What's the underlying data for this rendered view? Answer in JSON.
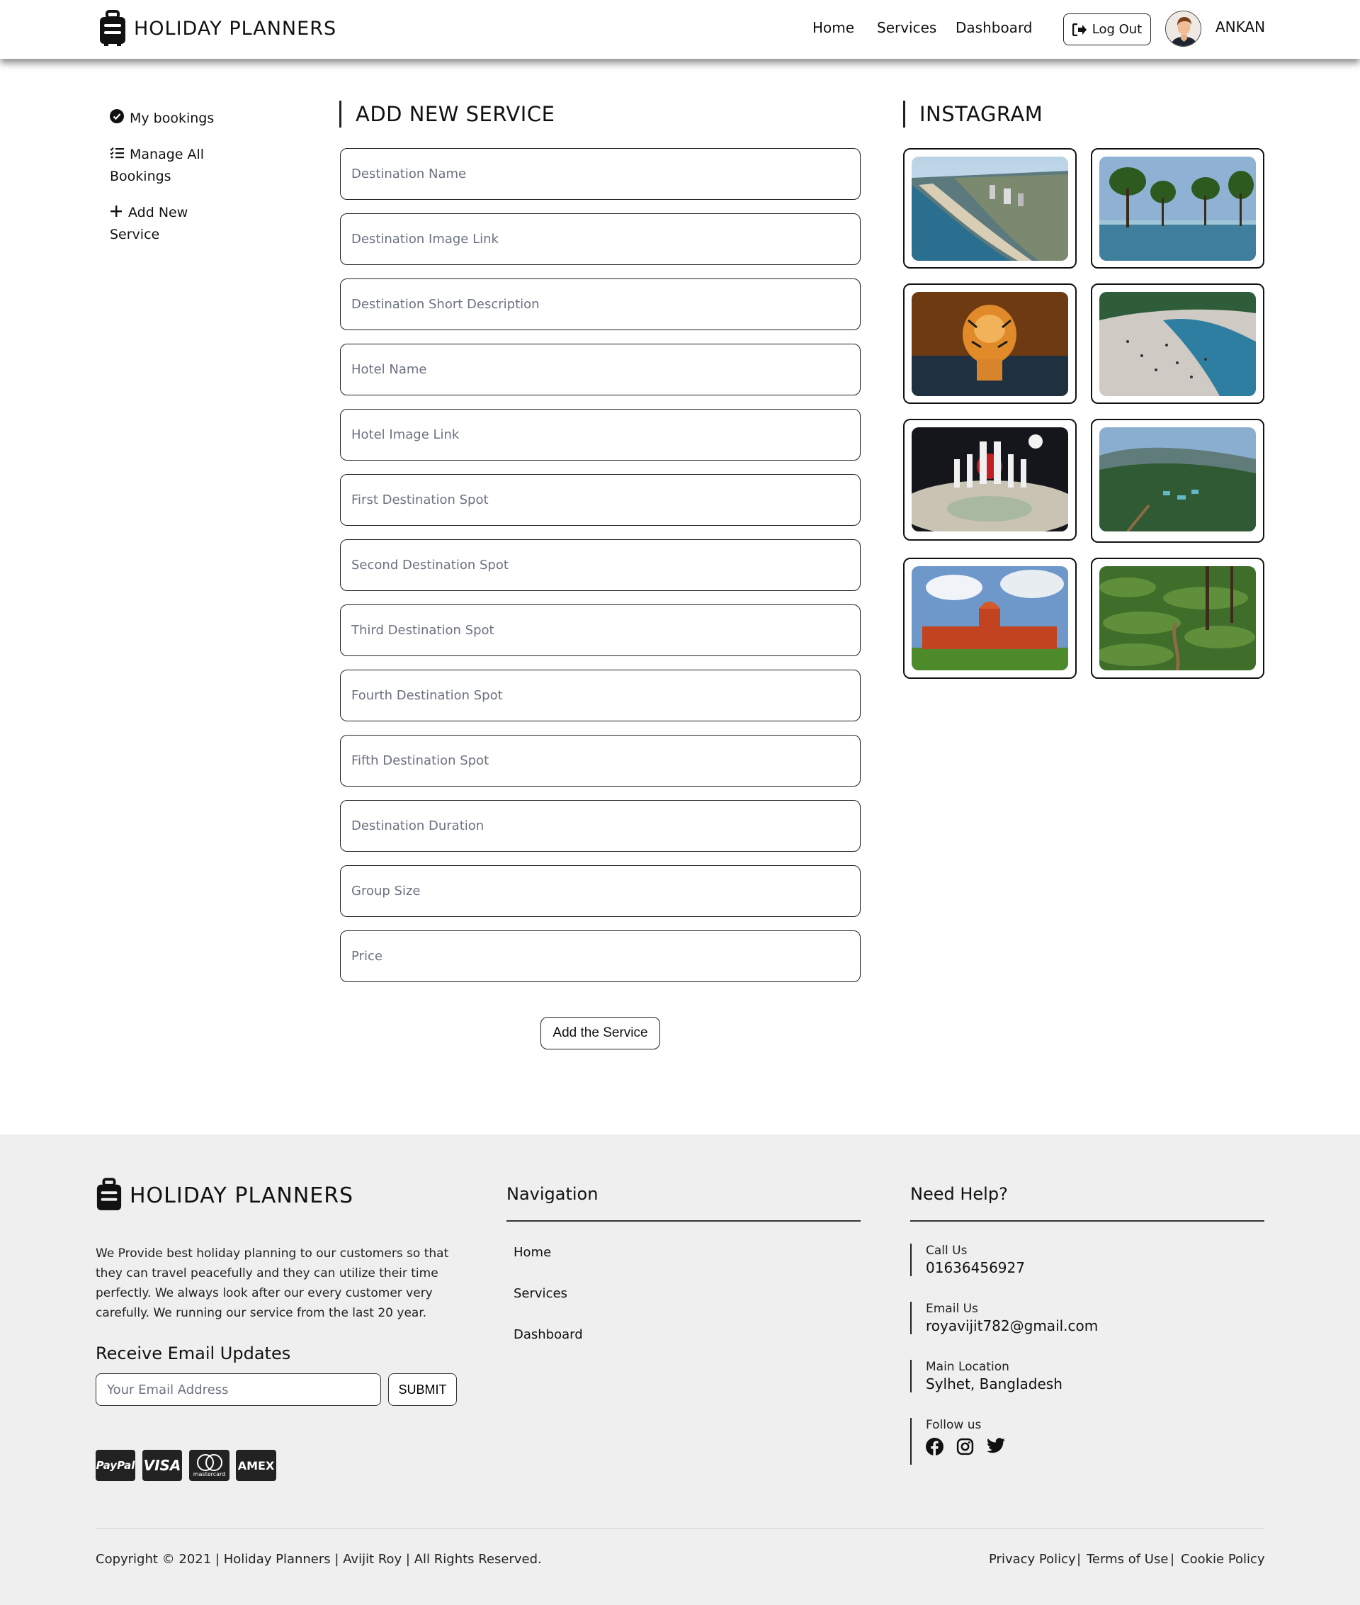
{
  "header": {
    "brand": "HOLIDAY PLANNERS",
    "nav": [
      "Home",
      "Services",
      "Dashboard"
    ],
    "logout_label": "Log Out",
    "user_name": "ANKAN"
  },
  "sidebar": {
    "items": [
      {
        "label": "My bookings",
        "icon": "check-circle-icon"
      },
      {
        "label_line1": "Manage All",
        "label_line2": "Bookings",
        "icon": "list-check-icon"
      },
      {
        "label_line1": "Add New",
        "label_line2": "Service",
        "icon": "plus-icon"
      }
    ]
  },
  "form": {
    "title": "ADD NEW SERVICE",
    "fields": [
      "Destination Name",
      "Destination Image Link",
      "Destination Short Description",
      "Hotel Name",
      "Hotel Image Link",
      "First Destination Spot",
      "Second Destination Spot",
      "Third Destination Spot",
      "Fourth Destination Spot",
      "Fifth Destination Spot",
      "Destination Duration",
      "Group Size",
      "Price"
    ],
    "submit_label": "Add the Service"
  },
  "instagram": {
    "title": "INSTAGRAM",
    "images": [
      "beach-aerial",
      "flooded-trees",
      "tiger-in-water",
      "river-crowd",
      "monument-night",
      "hill-resort",
      "red-palace",
      "tea-garden"
    ]
  },
  "footer": {
    "brand": "HOLIDAY PLANNERS",
    "about": "We Provide best holiday planning to our customers so that they can travel peacefully and they can utilize their time perfectly. We always look after our every customer very carefully. We running our service from the last 20 year.",
    "email_heading": "Receive Email Updates",
    "email_placeholder": "Your Email Address",
    "email_button": "SUBMIT",
    "payments": [
      "PayPal",
      "VISA",
      "mastercard",
      "AMEX"
    ],
    "nav_heading": "Navigation",
    "nav": [
      "Home",
      "Services",
      "Dashboard"
    ],
    "help_heading": "Need Help?",
    "contacts": [
      {
        "label": "Call Us",
        "value": "01636456927"
      },
      {
        "label": "Email Us",
        "value": "royavijit782@gmail.com"
      },
      {
        "label": "Main Location",
        "value": "Sylhet, Bangladesh"
      }
    ],
    "follow_label": "Follow us",
    "social": [
      "facebook-icon",
      "instagram-icon",
      "twitter-icon"
    ],
    "copyright": "Copyright © 2021 | Holiday Planners | Avijit Roy | All Rights Reserved.",
    "legal": [
      "Privacy Policy",
      "Terms of Use",
      "Cookie Policy"
    ],
    "legal_sep": "|"
  },
  "colors": {
    "accent": "#111111",
    "footer_bg": "#efefef",
    "placeholder": "#6b7280"
  }
}
